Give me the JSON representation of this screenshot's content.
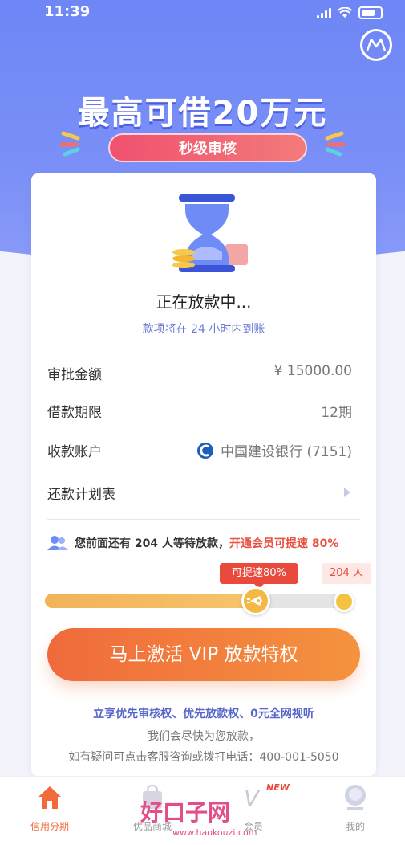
{
  "status": {
    "time": "11:39"
  },
  "hero": {
    "headline": "最高可借20万元",
    "pill": "秒级审核"
  },
  "loan": {
    "title": "正在放款中...",
    "subtitle": "款项将在 24 小时内到账"
  },
  "details": [
    {
      "label": "审批金额",
      "value": "¥ 15000.00"
    },
    {
      "label": "借款期限",
      "value": "12期"
    },
    {
      "label": "收款账户",
      "value": "中国建设银行 (7151)"
    },
    {
      "label": "还款计划表",
      "value": ""
    }
  ],
  "queue": {
    "text": "您前面还有 204 人等待放款，",
    "highlight": "开通会员可提速 80%"
  },
  "progress": {
    "speed_tag": "可提速80%",
    "count_tag": "204 人",
    "fill_fraction": 0.7
  },
  "cta": {
    "label": "马上激活 VIP 放款特权"
  },
  "perks": "立享优先审核权、优先放款权、0元全网视听",
  "notes": [
    "我们会尽快为您放款，",
    "如有疑问可点击客服咨询或拨打电话：400-001-5050"
  ],
  "tabs": [
    {
      "label": "信用分期",
      "icon": "house-icon",
      "active": true
    },
    {
      "label": "优品商城",
      "icon": "shopping-bag-icon",
      "active": false
    },
    {
      "label": "会员",
      "icon": "vip-icon",
      "active": false,
      "badge": "NEW"
    },
    {
      "label": "我的",
      "icon": "user-icon",
      "active": false
    }
  ],
  "watermark": {
    "title": "好口子网",
    "url": "www.haokouzi.com"
  },
  "colors": {
    "accent": "#f06a3c",
    "brand_blue": "#6e86f6",
    "highlight_red": "#e94a3c"
  }
}
